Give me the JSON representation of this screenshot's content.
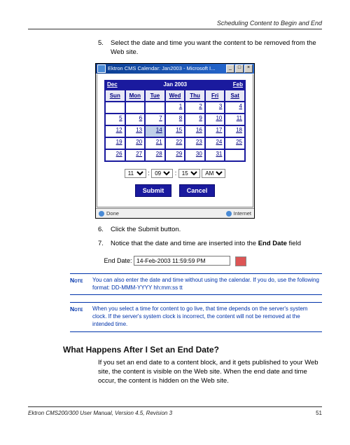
{
  "header": {
    "running_title": "Scheduling Content to Begin and End"
  },
  "steps": {
    "s5": {
      "num": "5.",
      "text": "Select the date and time you want the content to be removed from the Web site."
    },
    "s6": {
      "num": "6.",
      "text": "Click the Submit button."
    },
    "s7": {
      "num": "7.",
      "text_a": "Notice that the date and time are inserted into the ",
      "text_b": "End Date",
      "text_c": " field"
    }
  },
  "calendar": {
    "window_title": "Ektron CMS Calendar: Jan2003 - Microsoft I...",
    "prev": "Dec",
    "current": "Jan  2003",
    "next": "Feb",
    "days": [
      "Sun",
      "Mon",
      "Tue",
      "Wed",
      "Thu",
      "Fri",
      "Sat"
    ],
    "rows": [
      [
        "",
        "",
        "",
        "1",
        "2",
        "3",
        "4"
      ],
      [
        "5",
        "6",
        "7",
        "8",
        "9",
        "10",
        "11"
      ],
      [
        "12",
        "13",
        "14",
        "15",
        "16",
        "17",
        "18"
      ],
      [
        "19",
        "20",
        "21",
        "22",
        "23",
        "24",
        "25"
      ],
      [
        "26",
        "27",
        "28",
        "29",
        "30",
        "31",
        ""
      ]
    ],
    "selected": "14",
    "time": {
      "hour": "11",
      "min": "09",
      "sec": "15",
      "ampm": "AM"
    },
    "submit": "Submit",
    "cancel": "Cancel",
    "status_left": "Done",
    "status_right": "Internet"
  },
  "enddate": {
    "label": "End Date:",
    "value": "14-Feb-2003 11:59:59 PM"
  },
  "notes": {
    "label": "Note",
    "n1": "You can also enter the date and time without using the calendar. If you do, use the following format: DD-MMM-YYYY hh:mm:ss tt",
    "n2": "When you select a time for content to go live, that time depends on the server's system clock. If the server's system clock is incorrect, the content will not be removed at the intended time."
  },
  "section2": {
    "heading": "What Happens After I Set an End Date?",
    "para": "If you set an end date to a content block, and it gets published to your Web site, the content is visible on the Web site. When the end date and time occur, the content is hidden on the Web site."
  },
  "footer": {
    "left": "Ektron CMS200/300 User Manual, Version 4.5, Revision 3",
    "page": "51"
  }
}
